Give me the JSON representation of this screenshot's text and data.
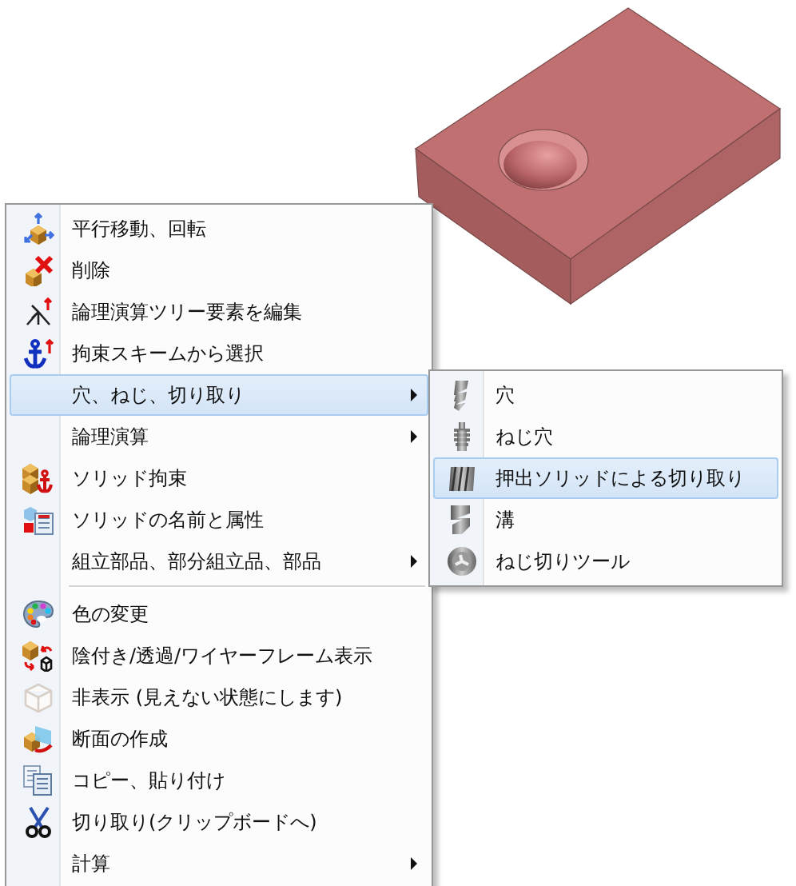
{
  "context_menu": {
    "items": [
      {
        "kind": "item",
        "label": "平行移動、回転",
        "selected": false,
        "submenu": false
      },
      {
        "kind": "item",
        "label": "削除",
        "selected": false,
        "submenu": false
      },
      {
        "kind": "item",
        "label": "論理演算ツリー要素を編集",
        "selected": false,
        "submenu": false
      },
      {
        "kind": "item",
        "label": "拘束スキームから選択",
        "selected": false,
        "submenu": false
      },
      {
        "kind": "item",
        "label": "穴、ねじ、切り取り",
        "selected": true,
        "submenu": true
      },
      {
        "kind": "item",
        "label": "論理演算",
        "selected": false,
        "submenu": true
      },
      {
        "kind": "item",
        "label": "ソリッド拘束",
        "selected": false,
        "submenu": false
      },
      {
        "kind": "item",
        "label": "ソリッドの名前と属性",
        "selected": false,
        "submenu": false
      },
      {
        "kind": "item",
        "label": "組立部品、部分組立品、部品",
        "selected": false,
        "submenu": true
      },
      {
        "kind": "separator"
      },
      {
        "kind": "item",
        "label": "色の変更",
        "selected": false,
        "submenu": false
      },
      {
        "kind": "item",
        "label": "陰付き/透過/ワイヤーフレーム表示",
        "selected": false,
        "submenu": false
      },
      {
        "kind": "item",
        "label": "非表示 (見えない状態にします)",
        "selected": false,
        "submenu": false
      },
      {
        "kind": "item",
        "label": "断面の作成",
        "selected": false,
        "submenu": false
      },
      {
        "kind": "item",
        "label": "コピー、貼り付け",
        "selected": false,
        "submenu": false
      },
      {
        "kind": "item",
        "label": "切り取り(クリップボードへ)",
        "selected": false,
        "submenu": false
      },
      {
        "kind": "item",
        "label": "計算",
        "selected": false,
        "submenu": true
      }
    ]
  },
  "submenu": {
    "items": [
      {
        "label": "穴",
        "selected": false
      },
      {
        "label": "ねじ穴",
        "selected": false
      },
      {
        "label": "押出ソリッドによる切り取り",
        "selected": true
      },
      {
        "label": "溝",
        "selected": false
      },
      {
        "label": "ねじ切りツール",
        "selected": false
      }
    ]
  }
}
